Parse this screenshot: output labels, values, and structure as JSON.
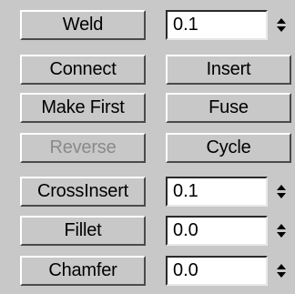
{
  "rows": [
    {
      "button": "Weld",
      "input_value": "0.1"
    },
    {
      "left_button": "Connect",
      "right_button": "Insert"
    },
    {
      "left_button": "Make First",
      "right_button": "Fuse"
    },
    {
      "left_button": "Reverse",
      "left_disabled": true,
      "right_button": "Cycle"
    },
    {
      "button": "CrossInsert",
      "input_value": "0.1"
    },
    {
      "button": "Fillet",
      "input_value": "0.0"
    },
    {
      "button": "Chamfer",
      "input_value": "0.0"
    }
  ]
}
